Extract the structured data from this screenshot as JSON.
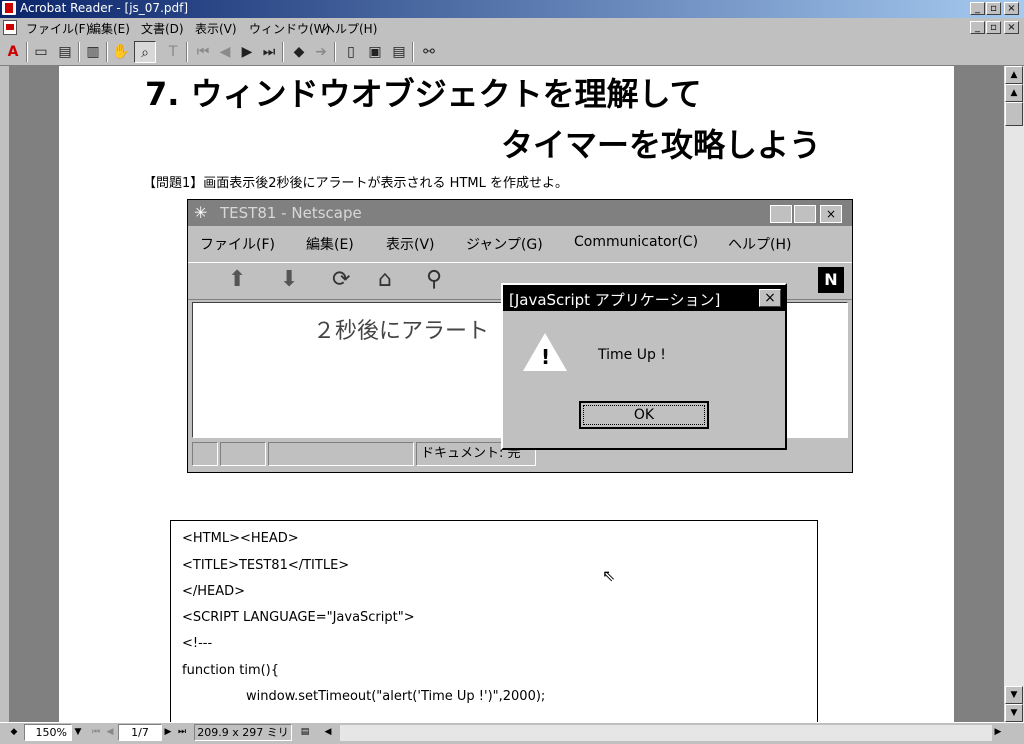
{
  "window": {
    "title": "Acrobat Reader - [js_07.pdf]",
    "controls": [
      "_",
      "▫",
      "×"
    ]
  },
  "menu": {
    "items": [
      "ファイル(F)",
      "編集(E)",
      "文書(D)",
      "表示(V)",
      "ウィンドウ(W)",
      "ヘルプ(H)"
    ]
  },
  "toolbar": {
    "icons": [
      "acrobat-icon",
      "open-icon",
      "print-icon",
      "page-only-icon",
      "hand-icon",
      "zoom-icon",
      "text-select-icon",
      "first-page-icon",
      "prev-page-icon",
      "next-page-icon",
      "last-page-icon",
      "go-back-icon",
      "go-forward-icon",
      "actual-size-icon",
      "fit-page-icon",
      "fit-width-icon",
      "find-icon"
    ]
  },
  "document": {
    "heading_line1": "7. ウィンドウオブジェクトを理解して",
    "heading_line2": "タイマーを攻略しよう",
    "problem": "【問題1】画面表示後2秒後にアラートが表示される HTML を作成せよ。",
    "netscape": {
      "title": "TEST81 - Netscape",
      "menus": [
        "ファイル(F)",
        "編集(E)",
        "表示(V)",
        "ジャンプ(G)",
        "Communicator(C)",
        "ヘルプ(H)"
      ],
      "content_text": "２秒後にアラート",
      "status_text": "ドキュメント: 完"
    },
    "alert": {
      "title": "[JavaScript アプリケーション]",
      "message": "Time Up !",
      "ok_label": "OK"
    },
    "code_lines": [
      "<HTML><HEAD>",
      "<TITLE>TEST81</TITLE>",
      "</HEAD>",
      "<SCRIPT LANGUAGE=\"JavaScript\">",
      "<!---",
      "function tim(){",
      "window.setTimeout(\"alert('Time Up !')\",2000);"
    ]
  },
  "statusbar": {
    "zoom": "150%",
    "page": "1/7",
    "page_size": "209.9 x 297 ミリ"
  }
}
